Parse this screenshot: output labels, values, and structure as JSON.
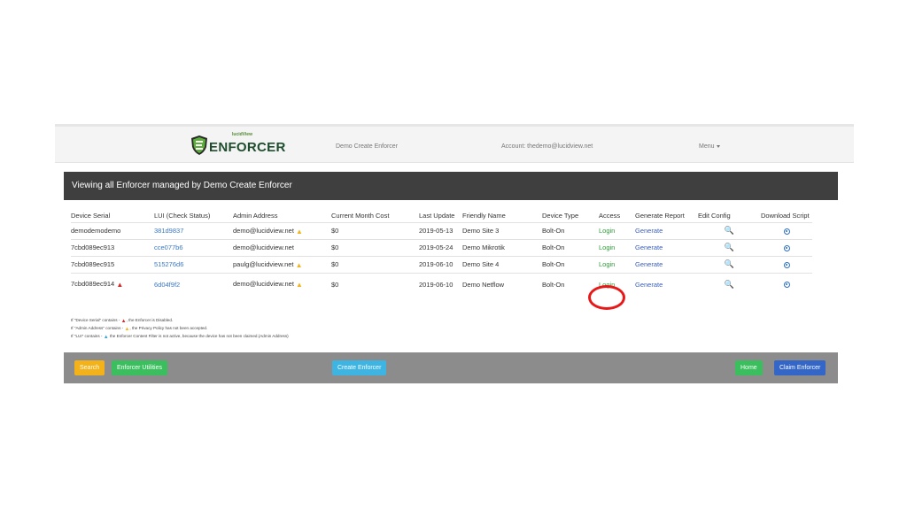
{
  "nav": {
    "logo_small": "lucidView",
    "logo_first": "E",
    "logo_rest": "NFORCER",
    "title": "Demo Create Enforcer",
    "account": "Account: thedemo@lucidview.net",
    "menu": "Menu"
  },
  "panel": {
    "heading": "Viewing all Enforcer managed by Demo Create Enforcer"
  },
  "table": {
    "headers": [
      "Device Serial",
      "LUI (Check Status)",
      "Admin Address",
      "Current Month Cost",
      "Last Update",
      "Friendly Name",
      "Device Type",
      "Access",
      "Generate Report",
      "Edit Config",
      "Download Script"
    ],
    "rows": [
      {
        "serial": "demodemodemo",
        "lui": "381d9837",
        "admin": "demo@lucidview.net",
        "cost": "$0",
        "updated": "2019-05-13",
        "name": "Demo Site 3",
        "type": "Bolt-On",
        "access": "Login",
        "report": "Generate"
      },
      {
        "serial": "7cbd089ec913",
        "lui": "cce077b6",
        "admin": "demo@lucidview.net",
        "cost": "$0",
        "updated": "2019-05-24",
        "name": "Demo Mikrotik",
        "type": "Bolt-On",
        "access": "Login",
        "report": "Generate"
      },
      {
        "serial": "7cbd089ec915",
        "lui": "515276d6",
        "admin": "paulg@lucidview.net",
        "cost": "$0",
        "updated": "2019-06-10",
        "name": "Demo Site 4",
        "type": "Bolt-On",
        "access": "Login",
        "report": "Generate"
      },
      {
        "serial": "7cbd089ec914",
        "lui": "6d04f9f2",
        "admin": "demo@lucidview.net",
        "cost": "$0",
        "updated": "2019-06-10",
        "name": "Demo Netflow",
        "type": "Bolt-On",
        "access": "Login",
        "report": "Generate"
      }
    ]
  },
  "legend": {
    "line1_a": "If \"Device Serial\" contains - ",
    "line1_b": ", the Enforcer is Disabled.",
    "line2_a": "If \"Admin Address\" contains - ",
    "line2_b": ", the Privacy Policy has not been accepted.",
    "line3_a": "If \"LUI\" contains - ",
    "line3_b": " the Enforcer Content Filter is not active, because the device has not been claimed.(Admin Address)"
  },
  "footer": {
    "search": "Search",
    "utilities": "Enforcer Utilities",
    "create": "Create Enforcer",
    "home": "Home",
    "claim": "Claim Enforcer"
  },
  "colors": {
    "header_bg": "#3f3f3f",
    "footer_bg": "#8c8c8c",
    "link_blue": "#3a78c3",
    "login_green": "#2e9c3a",
    "warning_red": "#d22b2b",
    "warning_yellow": "#f0b51f",
    "highlight_circle": "#e81818"
  },
  "icons": {
    "logo": "shield-icon",
    "warning": "warning-triangle-icon",
    "edit_config": "search-icon",
    "download": "download-circle-icon"
  }
}
